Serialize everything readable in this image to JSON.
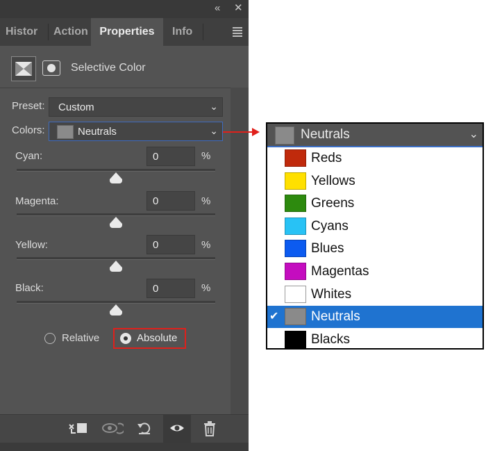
{
  "window_controls": {
    "collapse": "«",
    "close": "✕"
  },
  "tabs": [
    {
      "label": "Histor",
      "active": false
    },
    {
      "label": "Action",
      "active": false
    },
    {
      "label": "Properties",
      "active": true
    },
    {
      "label": "Info",
      "active": false
    }
  ],
  "panel": {
    "title": "Selective Color"
  },
  "preset": {
    "label": "Preset:",
    "value": "Custom"
  },
  "colors": {
    "label": "Colors:",
    "value": "Neutrals"
  },
  "sliders": [
    {
      "label": "Cyan:",
      "value": "0",
      "unit": "%"
    },
    {
      "label": "Magenta:",
      "value": "0",
      "unit": "%"
    },
    {
      "label": "Yellow:",
      "value": "0",
      "unit": "%"
    },
    {
      "label": "Black:",
      "value": "0",
      "unit": "%"
    }
  ],
  "method": {
    "relative_label": "Relative",
    "absolute_label": "Absolute",
    "selected": "Absolute"
  },
  "callout": {
    "header_value": "Neutrals",
    "options": [
      {
        "label": "Reds",
        "color": "#c02a0c",
        "selected": false
      },
      {
        "label": "Yellows",
        "color": "#ffe000",
        "selected": false
      },
      {
        "label": "Greens",
        "color": "#2d8a0e",
        "selected": false
      },
      {
        "label": "Cyans",
        "color": "#28c2f5",
        "selected": false
      },
      {
        "label": "Blues",
        "color": "#0c5bf0",
        "selected": false
      },
      {
        "label": "Magentas",
        "color": "#c40dbf",
        "selected": false
      },
      {
        "label": "Whites",
        "color": "#ffffff",
        "selected": false
      },
      {
        "label": "Neutrals",
        "color": "#8a8a8a",
        "selected": true
      },
      {
        "label": "Blacks",
        "color": "#000000",
        "selected": false
      }
    ]
  },
  "colors_theme": {
    "panel_bg": "#535353",
    "highlight_red": "#e0201b",
    "selection_blue": "#1f73d0"
  }
}
